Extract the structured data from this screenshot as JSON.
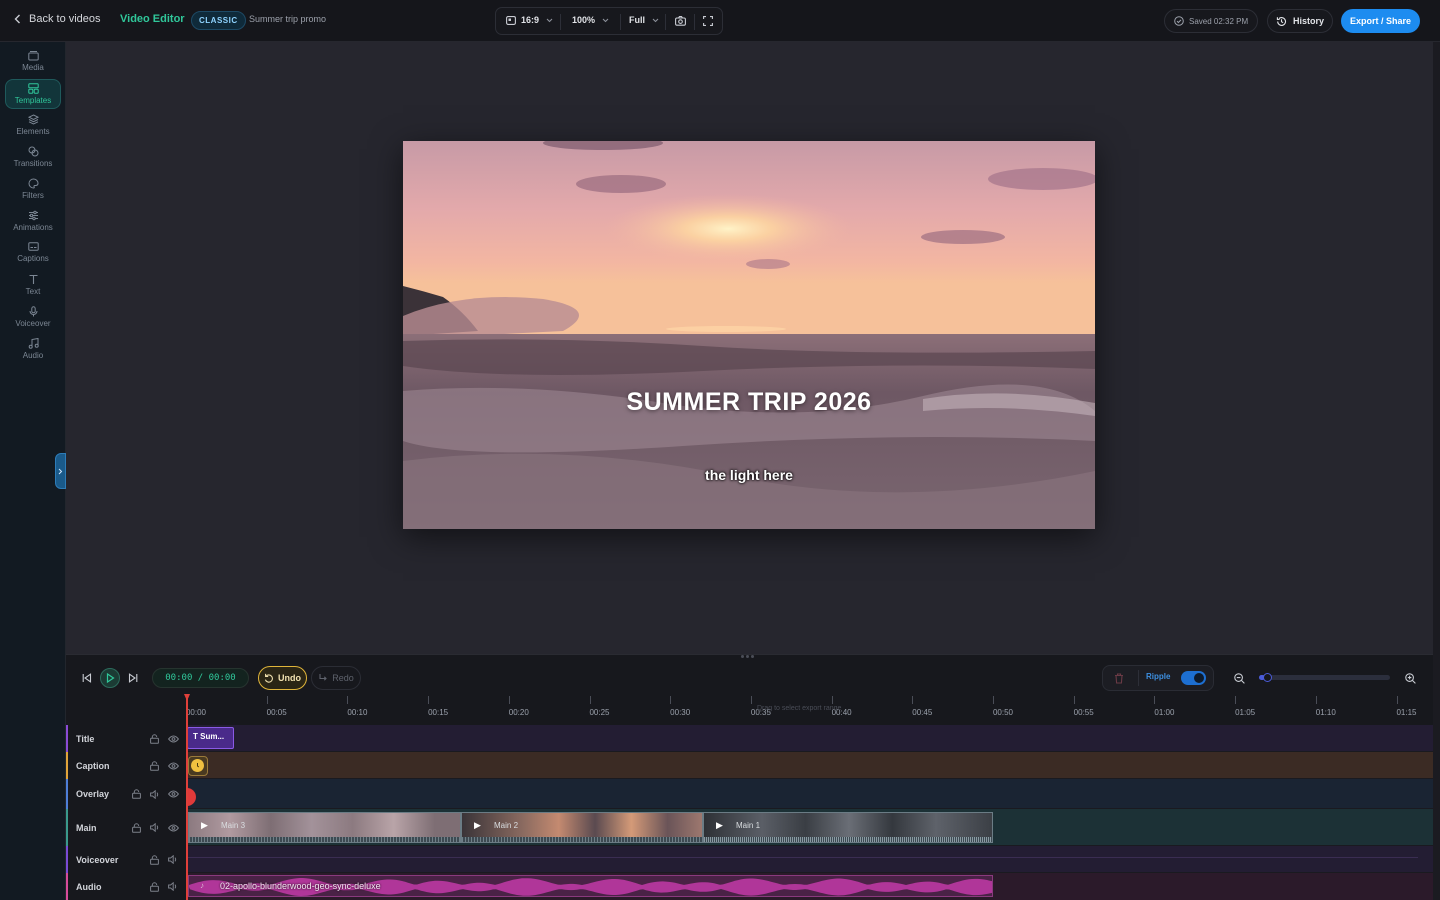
{
  "topbar": {
    "back_label": "Back to videos",
    "app_title": "Video Editor",
    "mode_badge": "CLASSIC",
    "project_name": "Summer trip promo",
    "aspect": "16:9",
    "zoom": "100%",
    "quality": "Full",
    "saved_status": "Saved 02:32 PM",
    "history_label": "History",
    "export_label": "Export / Share",
    "accent_color": "#1d8cf0",
    "brand_color": "#30c79a"
  },
  "sidebar": {
    "items": [
      {
        "label": "Media",
        "icon": "media-icon"
      },
      {
        "label": "Templates",
        "icon": "templates-icon",
        "active": true
      },
      {
        "label": "Elements",
        "icon": "elements-icon"
      },
      {
        "label": "Transitions",
        "icon": "transitions-icon"
      },
      {
        "label": "Filters",
        "icon": "filters-icon"
      },
      {
        "label": "Animations",
        "icon": "animations-icon"
      },
      {
        "label": "Captions",
        "icon": "captions-icon"
      },
      {
        "label": "Text",
        "icon": "text-icon"
      },
      {
        "label": "Voiceover",
        "icon": "voiceover-icon"
      },
      {
        "label": "Audio",
        "icon": "audio-icon"
      }
    ]
  },
  "preview": {
    "title_text": "SUMMER TRIP 2026",
    "caption_text": "the light here"
  },
  "timeline": {
    "timecode": "00:00 / 00:00",
    "undo_label": "Undo",
    "redo_label": "Redo",
    "ripple_label": "Ripple",
    "ripple_on": true,
    "zoom_level": 0.04,
    "hint_text": "Drag to select export range",
    "ticks": [
      "00:00",
      "00:05",
      "00:10",
      "00:15",
      "00:20",
      "00:25",
      "00:30",
      "00:35",
      "00:40",
      "00:45",
      "00:50",
      "00:55",
      "01:00",
      "01:05",
      "01:10",
      "01:15"
    ],
    "tracks": [
      {
        "name": "Title",
        "color": "#8a4bd6"
      },
      {
        "name": "Caption",
        "color": "#e0a43a"
      },
      {
        "name": "Overlay",
        "color": "#4e7fd8"
      },
      {
        "name": "Main",
        "color": "#3a9a8c"
      },
      {
        "name": "Voiceover",
        "color": "#7a4bd6"
      },
      {
        "name": "Audio",
        "color": "#d64b9a"
      }
    ],
    "clips": {
      "title_clip": "T Sum...",
      "main_clips": [
        "Main 3",
        "Main 2",
        "Main 1"
      ],
      "audio_clip": "02-apollo-blunderwood-geo-sync-deluxe"
    }
  }
}
